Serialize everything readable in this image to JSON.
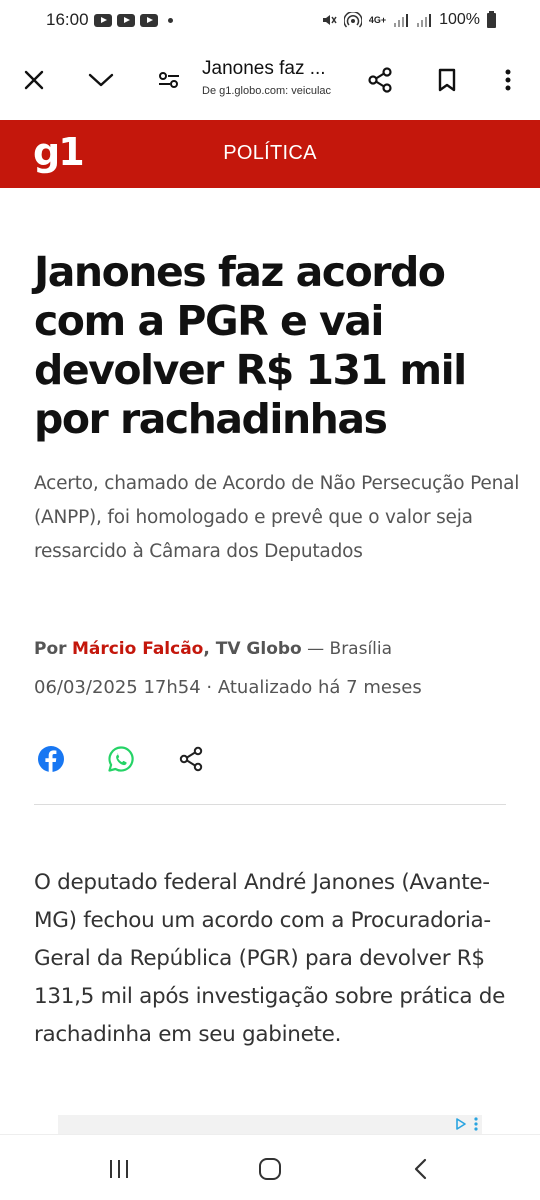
{
  "status_bar": {
    "time": "16:00",
    "battery": "100%",
    "network": "4G+"
  },
  "browser": {
    "page_title": "Janones faz ...",
    "source_line": "De g1.globo.com: veiculac"
  },
  "site": {
    "logo": "g1",
    "section": "POLÍTICA",
    "brand_color": "#c4170c"
  },
  "article": {
    "headline": "Janones faz acordo com a PGR e vai devolver R$ 131 mil por rachadinhas",
    "subheadline": "Acerto, chamado de Acordo de Não Persecução Penal (ANPP), foi homologado e prevê que o valor seja ressarcido à Câmara dos Deputados",
    "byline_prefix": "Por",
    "author": "Márcio Falcão",
    "org": ", TV Globo",
    "location": " — Brasília",
    "dateline": "06/03/2025 17h54 · Atualizado há 7 meses",
    "body": "O deputado federal André Janones (Avante-MG) fechou um acordo com a Procuradoria-Geral da República (PGR) para devolver R$ 131,5 mil após investigação sobre prática de rachadinha em seu gabinete."
  },
  "share": {
    "facebook_color": "#1877f2",
    "whatsapp_color": "#25d366"
  },
  "icons": [
    "close-icon",
    "chevron-down-icon",
    "page-settings-icon",
    "share-icon",
    "bookmark-icon",
    "more-vert-icon",
    "facebook-icon",
    "whatsapp-icon",
    "recents-icon",
    "home-icon",
    "back-icon"
  ]
}
